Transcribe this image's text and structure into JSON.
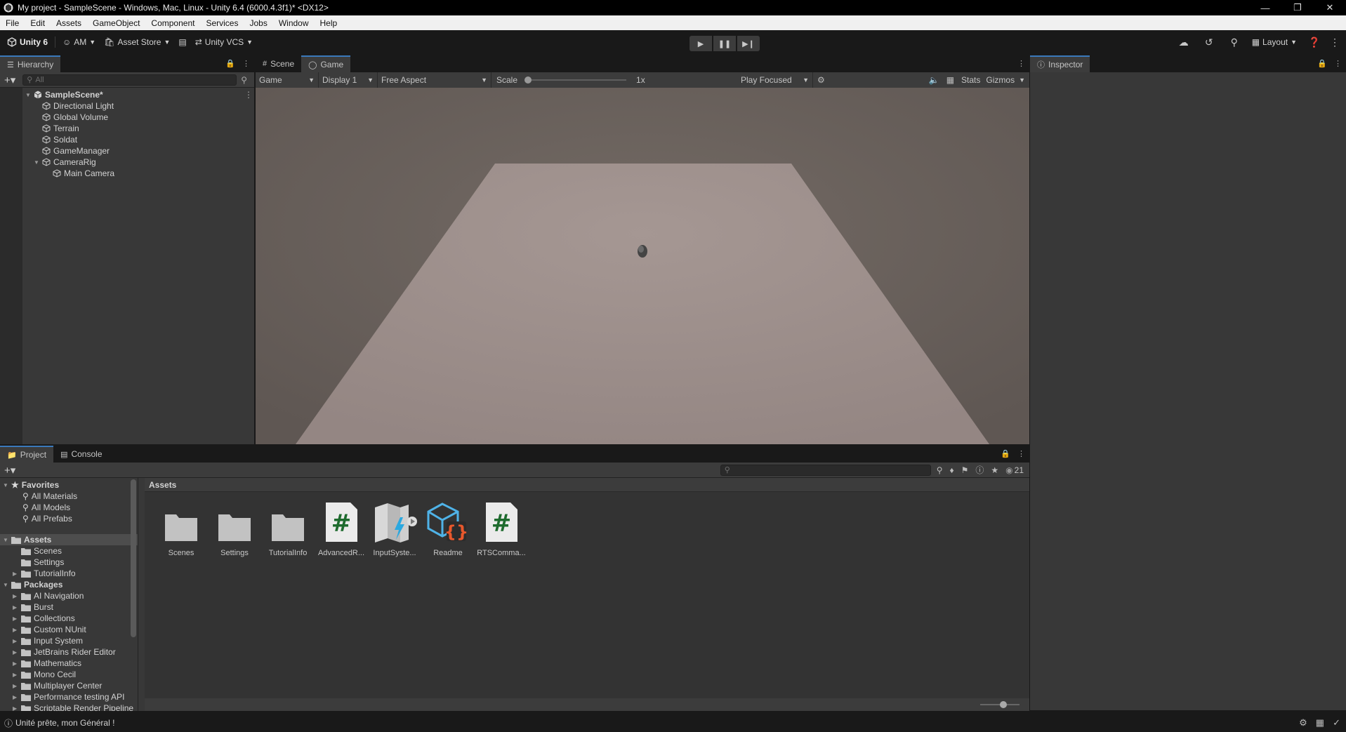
{
  "window": {
    "title": "My project - SampleScene - Windows, Mac, Linux - Unity 6.4 (6000.4.3f1)* <DX12>"
  },
  "menu": [
    "File",
    "Edit",
    "Assets",
    "GameObject",
    "Component",
    "Services",
    "Jobs",
    "Window",
    "Help"
  ],
  "toolbar": {
    "unity_label": "Unity 6",
    "account_label": "AM",
    "asset_store_label": "Asset Store",
    "vcs_label": "Unity VCS",
    "layout_label": "Layout"
  },
  "hierarchy": {
    "tab_label": "Hierarchy",
    "search_placeholder": "All",
    "scene_name": "SampleScene*",
    "items": [
      {
        "label": "Directional Light"
      },
      {
        "label": "Global Volume"
      },
      {
        "label": "Terrain"
      },
      {
        "label": "Soldat"
      },
      {
        "label": "GameManager"
      },
      {
        "label": "CameraRig"
      },
      {
        "label": "Main Camera"
      }
    ]
  },
  "game": {
    "tabs": [
      {
        "label": "Scene"
      },
      {
        "label": "Game"
      }
    ],
    "view_dropdown": "Game",
    "display_dropdown": "Display 1",
    "aspect_dropdown": "Free Aspect",
    "scale_label": "Scale",
    "scale_value": "1x",
    "play_mode_dropdown": "Play Focused",
    "stats_label": "Stats",
    "gizmos_label": "Gizmos"
  },
  "inspector": {
    "tab_label": "Inspector"
  },
  "project": {
    "tabs": [
      {
        "label": "Project"
      },
      {
        "label": "Console"
      }
    ],
    "asset_count": "21",
    "favorites_label": "Favorites",
    "favorites": [
      {
        "label": "All Materials"
      },
      {
        "label": "All Models"
      },
      {
        "label": "All Prefabs"
      }
    ],
    "assets_root": "Assets",
    "asset_folders": [
      {
        "label": "Scenes"
      },
      {
        "label": "Settings"
      },
      {
        "label": "TutorialInfo"
      }
    ],
    "packages_label": "Packages",
    "packages": [
      {
        "label": "AI Navigation"
      },
      {
        "label": "Burst"
      },
      {
        "label": "Collections"
      },
      {
        "label": "Custom NUnit"
      },
      {
        "label": "Input System"
      },
      {
        "label": "JetBrains Rider Editor"
      },
      {
        "label": "Mathematics"
      },
      {
        "label": "Mono Cecil"
      },
      {
        "label": "Multiplayer Center"
      },
      {
        "label": "Performance testing API"
      },
      {
        "label": "Scriptable Render Pipeline"
      }
    ],
    "breadcrumb": "Assets",
    "grid_assets": [
      {
        "label": "Scenes",
        "icon": "folder-icon"
      },
      {
        "label": "Settings",
        "icon": "folder-icon"
      },
      {
        "label": "TutorialInfo",
        "icon": "folder-icon"
      },
      {
        "label": "AdvancedR...",
        "icon": "csharp-script-icon"
      },
      {
        "label": "InputSyste...",
        "icon": "input-actions-icon"
      },
      {
        "label": "Readme",
        "icon": "readme-icon"
      },
      {
        "label": "RTSComma...",
        "icon": "csharp-script-icon"
      }
    ]
  },
  "status": {
    "message": "Unité prête, mon Général !"
  },
  "colors": {
    "accent": "#3a79bb",
    "ground": "#9c8e8b",
    "sky": "#6b625d"
  }
}
